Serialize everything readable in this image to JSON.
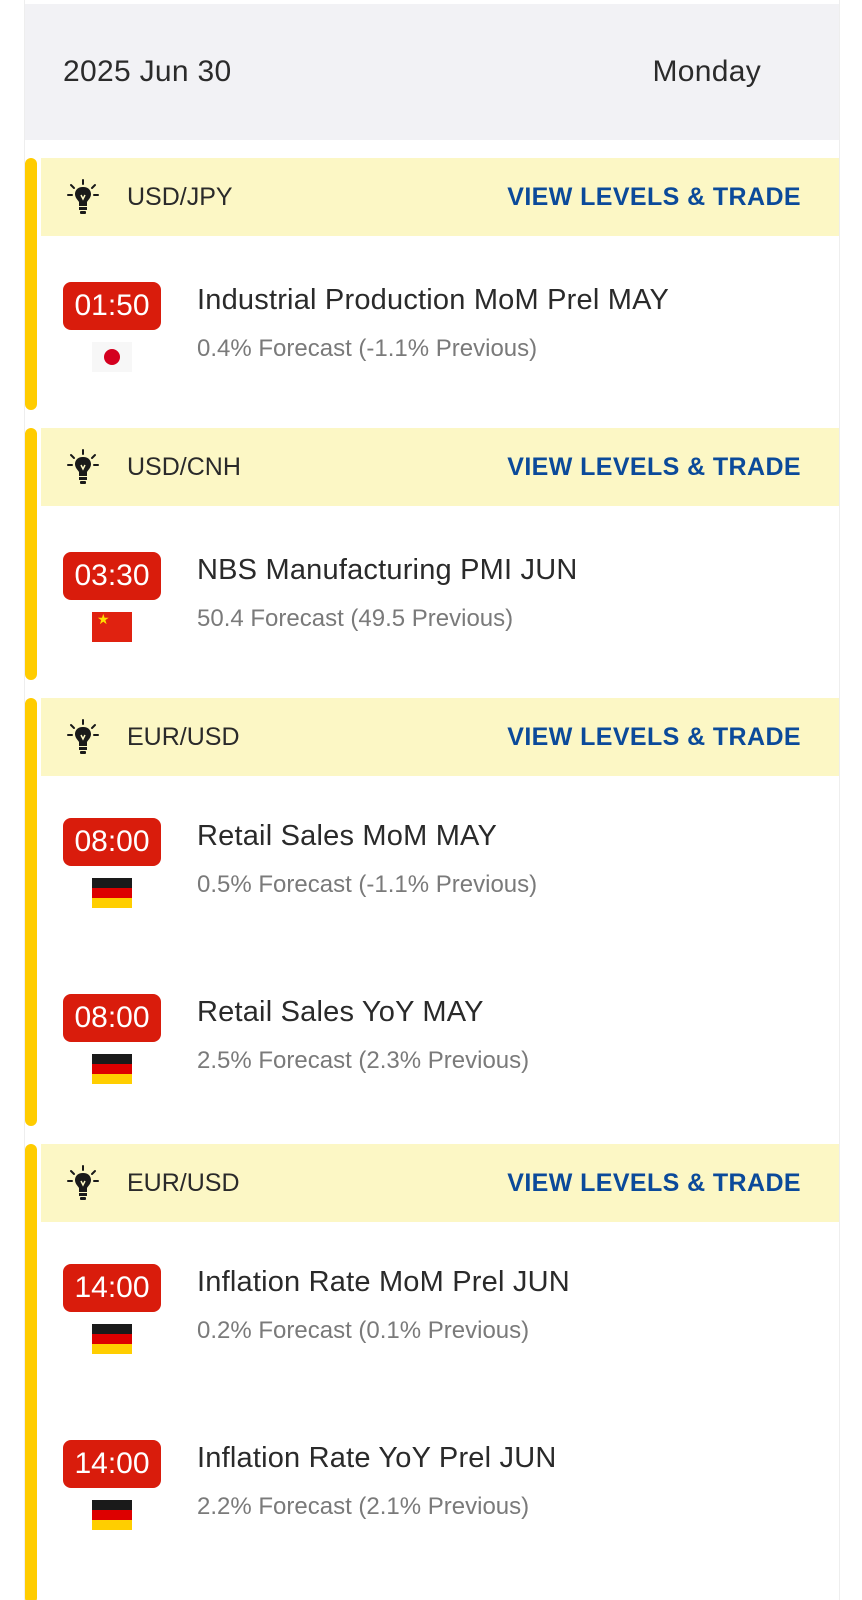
{
  "header": {
    "date": "2025 Jun 30",
    "weekday": "Monday"
  },
  "groups": [
    {
      "pair": "USD/JPY",
      "trade_label": "VIEW LEVELS & TRADE",
      "events": [
        {
          "time": "01:50",
          "flag": "japan-flag-icon",
          "title": "Industrial Production MoM Prel MAY",
          "detail": "0.4% Forecast (-1.1% Previous)"
        }
      ]
    },
    {
      "pair": "USD/CNH",
      "trade_label": "VIEW LEVELS & TRADE",
      "events": [
        {
          "time": "03:30",
          "flag": "china-flag-icon",
          "title": "NBS Manufacturing PMI JUN",
          "detail": "50.4 Forecast (49.5 Previous)"
        }
      ]
    },
    {
      "pair": "EUR/USD",
      "trade_label": "VIEW LEVELS & TRADE",
      "events": [
        {
          "time": "08:00",
          "flag": "germany-flag-icon",
          "title": "Retail Sales MoM MAY",
          "detail": "0.5% Forecast (-1.1% Previous)"
        },
        {
          "time": "08:00",
          "flag": "germany-flag-icon",
          "title": "Retail Sales YoY MAY",
          "detail": "2.5% Forecast (2.3% Previous)"
        }
      ]
    },
    {
      "pair": "EUR/USD",
      "trade_label": "VIEW LEVELS & TRADE",
      "events": [
        {
          "time": "14:00",
          "flag": "germany-flag-icon",
          "title": "Inflation Rate MoM Prel JUN",
          "detail": "0.2% Forecast (0.1% Previous)"
        },
        {
          "time": "14:00",
          "flag": "germany-flag-icon",
          "title": "Inflation Rate YoY Prel JUN",
          "detail": "2.2% Forecast (2.1% Previous)"
        }
      ]
    }
  ],
  "colors": {
    "accent_stripe": "#ffcc00",
    "group_header_bg": "#fcf7c5",
    "time_badge": "#d91c0c",
    "link": "#0b4a9a"
  },
  "icons": {
    "group": "lightbulb-icon"
  }
}
